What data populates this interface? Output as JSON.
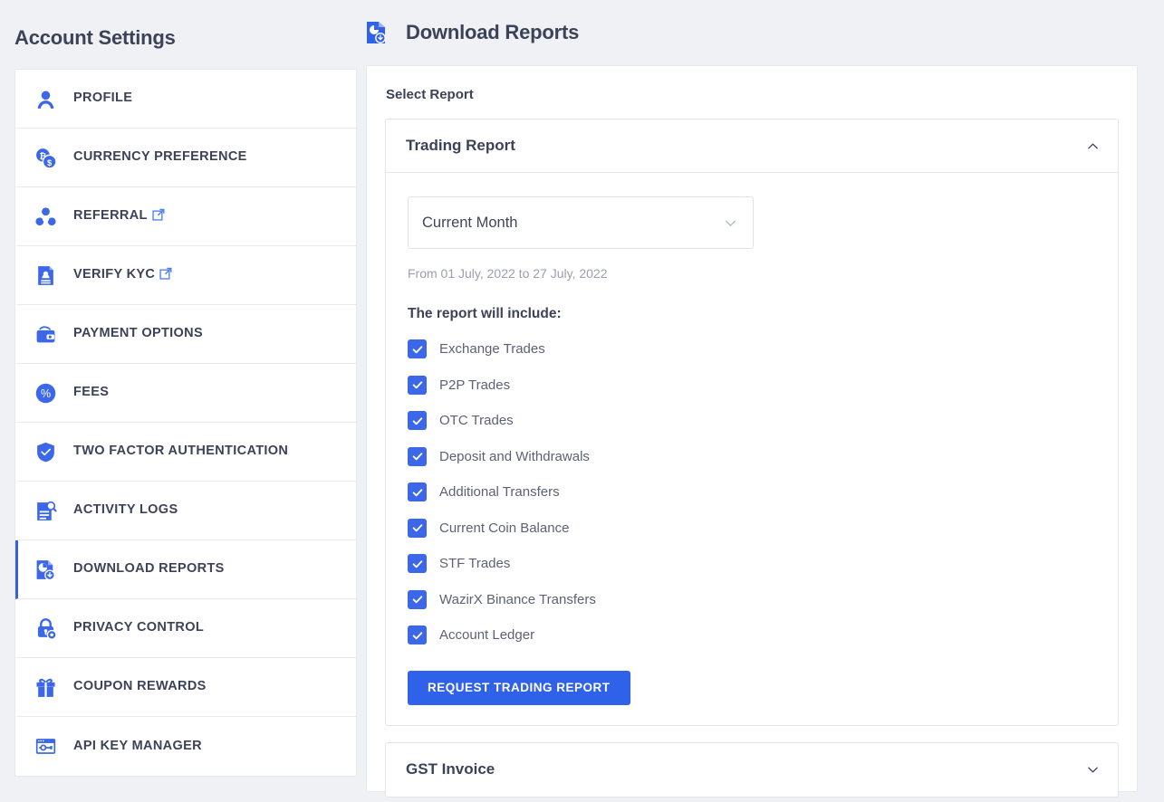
{
  "sidebar": {
    "title": "Account Settings",
    "items": [
      {
        "label": "PROFILE",
        "icon": "profile-icon",
        "external": false,
        "active": false
      },
      {
        "label": "CURRENCY PREFERENCE",
        "icon": "currency-icon",
        "external": false,
        "active": false
      },
      {
        "label": "REFERRAL",
        "icon": "referral-icon",
        "external": true,
        "active": false
      },
      {
        "label": "VERIFY KYC",
        "icon": "kyc-icon",
        "external": true,
        "active": false
      },
      {
        "label": "PAYMENT OPTIONS",
        "icon": "wallet-icon",
        "external": false,
        "active": false
      },
      {
        "label": "FEES",
        "icon": "percent-icon",
        "external": false,
        "active": false
      },
      {
        "label": "TWO FACTOR AUTHENTICATION",
        "icon": "shield-check-icon",
        "external": false,
        "active": false
      },
      {
        "label": "ACTIVITY LOGS",
        "icon": "document-search-icon",
        "external": false,
        "active": false
      },
      {
        "label": "DOWNLOAD REPORTS",
        "icon": "report-download-icon",
        "external": false,
        "active": true
      },
      {
        "label": "PRIVACY CONTROL",
        "icon": "lock-gear-icon",
        "external": false,
        "active": false
      },
      {
        "label": "COUPON REWARDS",
        "icon": "gift-icon",
        "external": false,
        "active": false
      },
      {
        "label": "API KEY MANAGER",
        "icon": "api-window-icon",
        "external": false,
        "active": false
      }
    ]
  },
  "header": {
    "title": "Download Reports",
    "icon": "report-download-icon"
  },
  "main": {
    "select_report_label": "Select Report",
    "trading_report": {
      "title": "Trading Report",
      "expanded": true,
      "chevron": "chevron-up-icon",
      "period_select": {
        "value": "Current Month",
        "chevron": "chevron-down-icon"
      },
      "date_range": "From 01 July, 2022 to 27 July, 2022",
      "include_title": "The report will include:",
      "options": [
        {
          "label": "Exchange Trades",
          "checked": true
        },
        {
          "label": "P2P Trades",
          "checked": true
        },
        {
          "label": "OTC Trades",
          "checked": true
        },
        {
          "label": "Deposit and Withdrawals",
          "checked": true
        },
        {
          "label": "Additional Transfers",
          "checked": true
        },
        {
          "label": "Current Coin Balance",
          "checked": true
        },
        {
          "label": "STF Trades",
          "checked": true
        },
        {
          "label": "WazirX Binance Transfers",
          "checked": true
        },
        {
          "label": "Account Ledger",
          "checked": true
        }
      ],
      "request_button": "REQUEST TRADING REPORT"
    },
    "gst_invoice": {
      "title": "GST Invoice",
      "expanded": false,
      "chevron": "chevron-down-icon"
    }
  },
  "colors": {
    "accent": "#2f62e8",
    "icon_blue": "#3b67e8",
    "text_dark": "#3c4257",
    "text_muted": "#9aa0af",
    "page_bg": "#f0f1f5",
    "card_bg": "#ffffff",
    "border": "#e6e8ec"
  }
}
